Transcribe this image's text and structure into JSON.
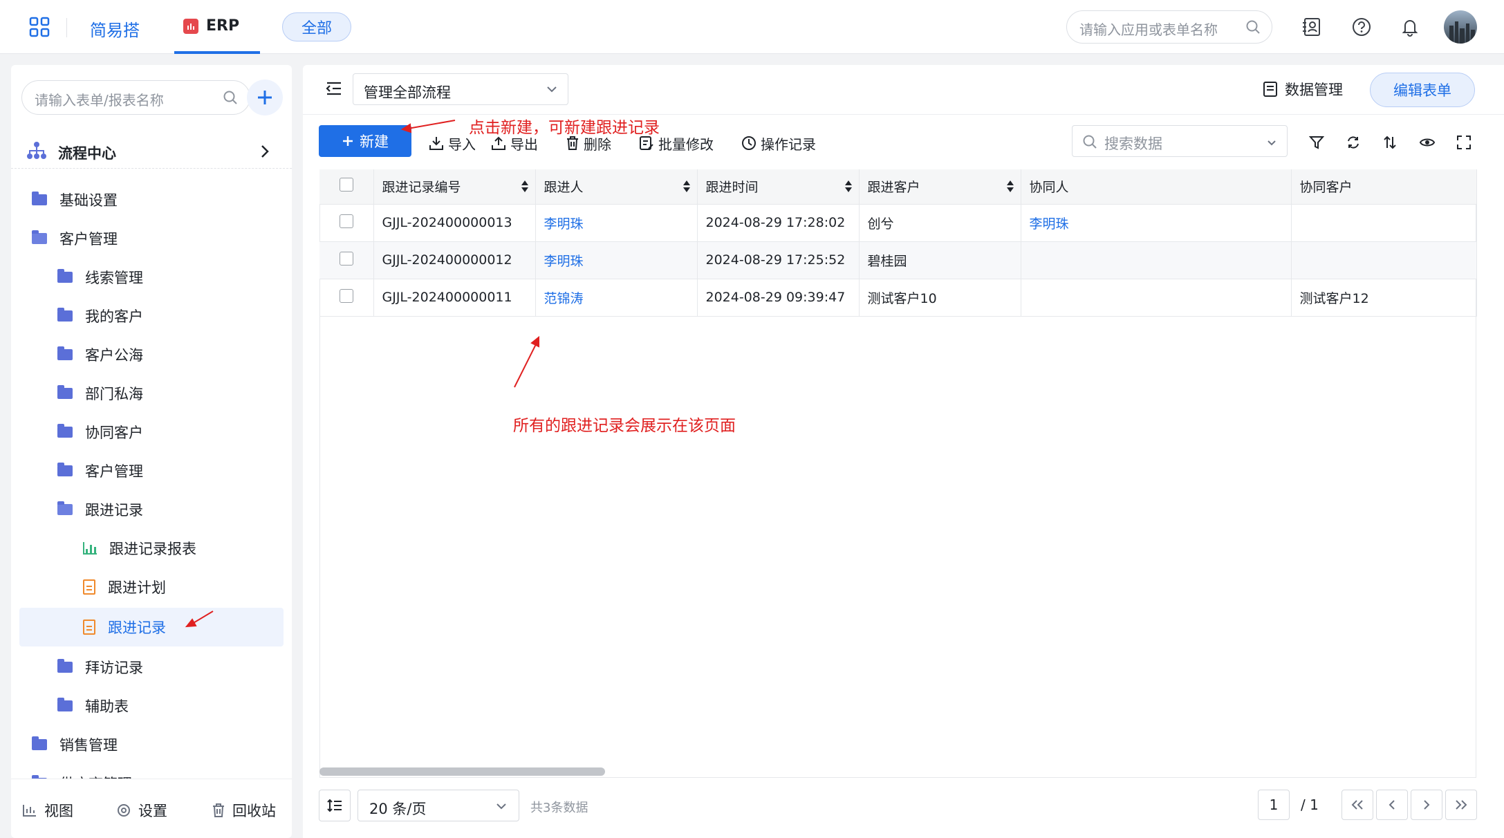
{
  "topbar": {
    "app_name": "简易搭",
    "tab_erp": "ERP",
    "filter_all": "全部",
    "search_placeholder": "请输入应用或表单名称"
  },
  "sidebar": {
    "search_placeholder": "请输入表单/报表名称",
    "section_title": "流程中心",
    "items": [
      {
        "label": "基础设置"
      },
      {
        "label": "客户管理"
      },
      {
        "label": "线索管理"
      },
      {
        "label": "我的客户"
      },
      {
        "label": "客户公海"
      },
      {
        "label": "部门私海"
      },
      {
        "label": "协同客户"
      },
      {
        "label": "客户管理"
      },
      {
        "label": "跟进记录"
      },
      {
        "label": "跟进记录报表"
      },
      {
        "label": "跟进计划"
      },
      {
        "label": "跟进记录"
      },
      {
        "label": "拜访记录"
      },
      {
        "label": "辅助表"
      },
      {
        "label": "销售管理"
      },
      {
        "label": "供应商管理"
      }
    ],
    "footer": {
      "view": "视图",
      "settings": "设置",
      "recycle": "回收站"
    }
  },
  "main": {
    "flow_select": "管理全部流程",
    "data_manage": "数据管理",
    "edit_form": "编辑表单",
    "toolbar": {
      "new": "新建",
      "import": "导入",
      "export": "导出",
      "delete": "删除",
      "batch_edit": "批量修改",
      "history": "操作记录",
      "search_placeholder": "搜索数据"
    },
    "table": {
      "columns": [
        "跟进记录编号",
        "跟进人",
        "跟进时间",
        "跟进客户",
        "协同人",
        "协同客户"
      ],
      "rows": [
        {
          "id": "GJJL-202400000013",
          "person": "李明珠",
          "time": "2024-08-29 17:28:02",
          "customer": "创兮",
          "collab": "李明珠",
          "collab_customer": ""
        },
        {
          "id": "GJJL-202400000012",
          "person": "李明珠",
          "time": "2024-08-29 17:25:52",
          "customer": "碧桂园",
          "collab": "",
          "collab_customer": ""
        },
        {
          "id": "GJJL-202400000011",
          "person": "范锦涛",
          "time": "2024-08-29 09:39:47",
          "customer": "测试客户10",
          "collab": "",
          "collab_customer": "测试客户12"
        }
      ]
    },
    "pagination": {
      "page_size": "20 条/页",
      "total": "共3条数据",
      "current_page": "1",
      "total_pages": "/ 1"
    }
  },
  "annotations": {
    "new_hint": "点击新建，可新建跟进记录",
    "page_hint": "所有的跟进记录会展示在该页面"
  },
  "colors": {
    "accent": "#1f6fe6",
    "annotation": "#e02020",
    "folder": "#5b6fd8"
  }
}
